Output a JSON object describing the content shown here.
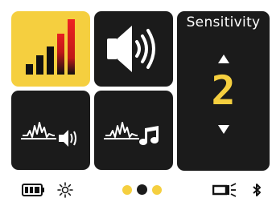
{
  "sensitivity": {
    "title": "Sensitivity",
    "value": "2"
  },
  "menu": {
    "tiles": [
      "signal-level",
      "volume",
      "sensitivity",
      "tone",
      "audio"
    ],
    "selected": "signal-level"
  },
  "status_bar": {
    "battery_icon": "battery-full-icon",
    "brightness_icon": "brightness-icon",
    "page_dots": [
      {
        "state": "inactive",
        "color": "#f5cf3f"
      },
      {
        "state": "active",
        "color": "#1b1b1b"
      },
      {
        "state": "inactive",
        "color": "#f5cf3f"
      }
    ],
    "flashlight_icon": "flashlight-icon",
    "bluetooth_icon": "bluetooth-icon"
  },
  "colors": {
    "accent": "#f5cf3f",
    "tile_dark": "#1b1b1b",
    "signal_red": "#e02020"
  }
}
